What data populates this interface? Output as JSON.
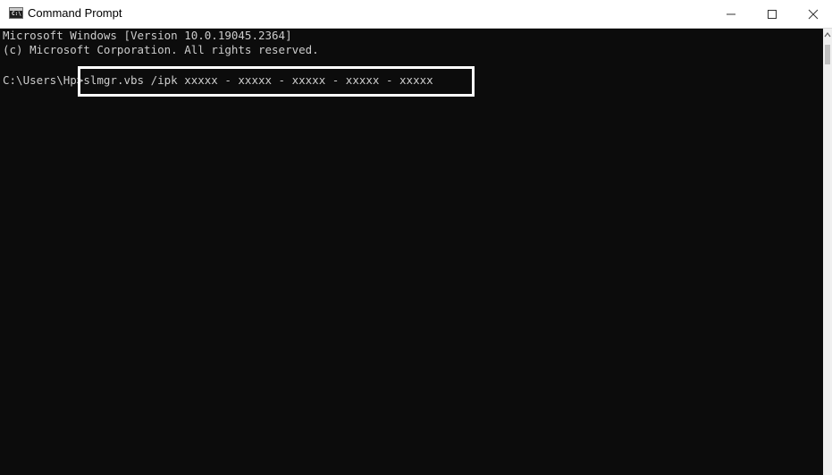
{
  "window": {
    "title": "Command Prompt",
    "icon": "cmd-app-icon",
    "controls": [
      "minimize-icon",
      "maximize-icon",
      "close-icon"
    ]
  },
  "console": {
    "line1": "Microsoft Windows [Version 10.0.19045.2364]",
    "line2": "(c) Microsoft Corporation. All rights reserved.",
    "prompt": "C:\\Users\\Hp>",
    "command": "slmgr.vbs /ipk xxxxx - xxxxx - xxxxx - xxxxx - xxxxx"
  },
  "colors": {
    "console_bg": "#0c0c0c",
    "console_text": "#cccccc",
    "highlight_border": "#ffffff"
  }
}
